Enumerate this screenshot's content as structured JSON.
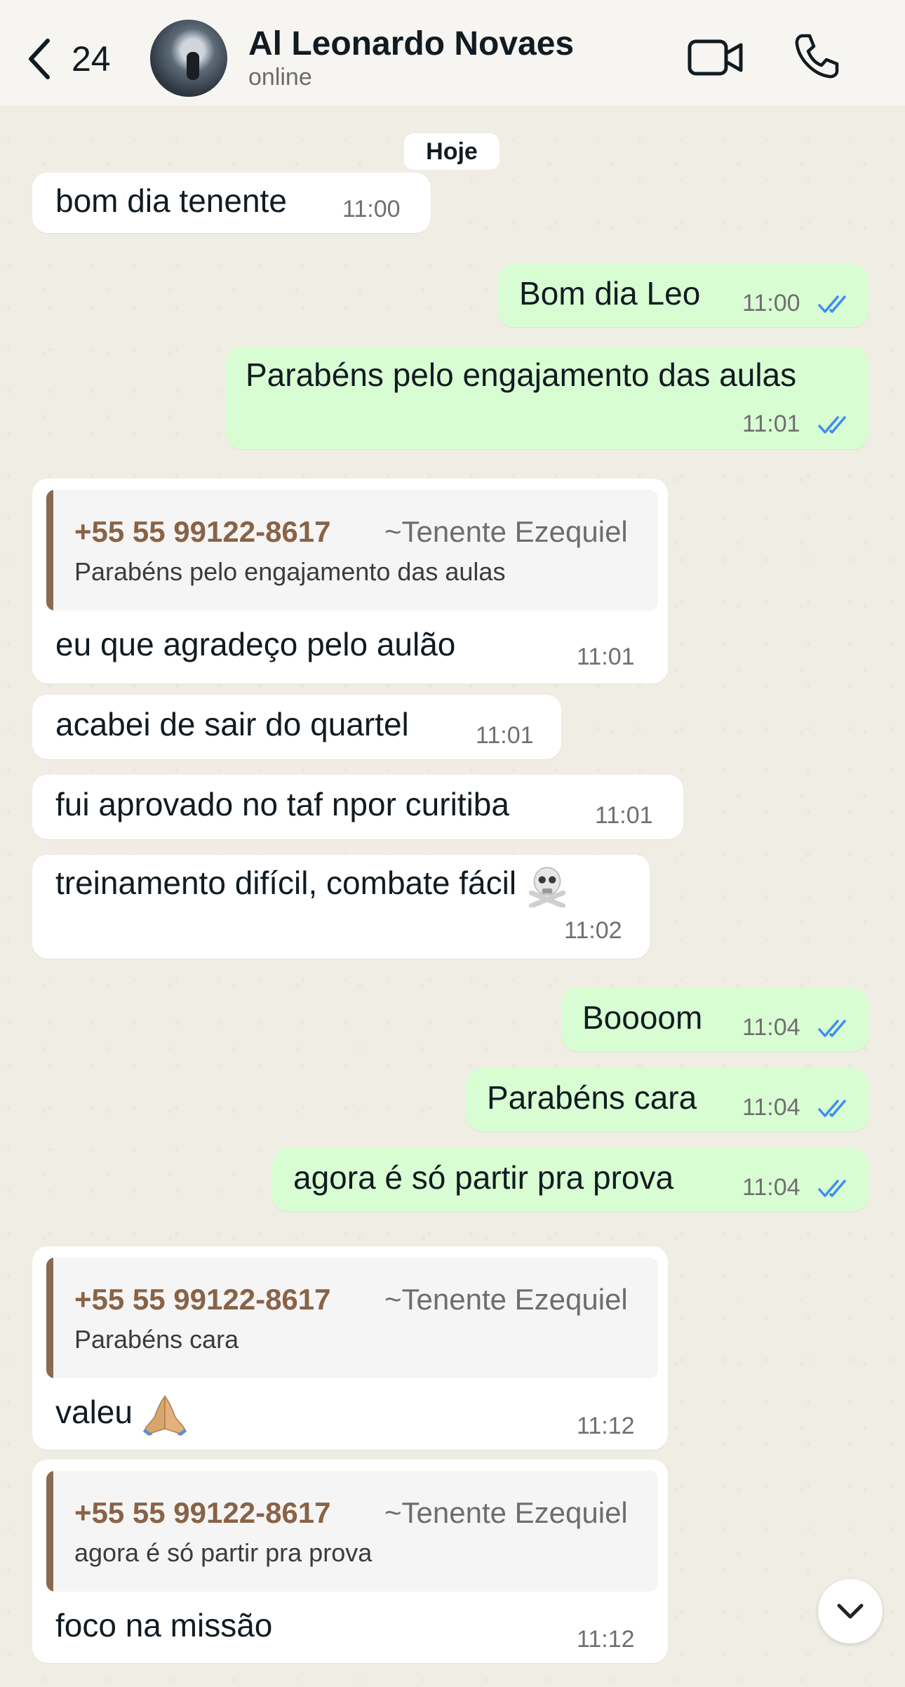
{
  "header": {
    "back_count": "24",
    "contact_name": "Al Leonardo Novaes",
    "status": "online"
  },
  "date_chip": "Hoje",
  "quote_phone": "+55 55 99122-8617",
  "quote_alias": "~Tenente Ezequiel",
  "messages": [
    {
      "dir": "in",
      "text": "bom dia tenente",
      "time": "11:00"
    },
    {
      "dir": "out",
      "text": "Bom dia Leo",
      "time": "11:00"
    },
    {
      "dir": "out",
      "text": "Parabéns pelo engajamento das aulas",
      "time": "11:01"
    },
    {
      "dir": "in",
      "quote": "Parabéns pelo engajamento das aulas",
      "text": "eu que agradeço pelo aulão",
      "time": "11:01"
    },
    {
      "dir": "in",
      "text": "acabei de sair do quartel",
      "time": "11:01"
    },
    {
      "dir": "in",
      "text": "fui aprovado no taf npor curitiba",
      "time": "11:01"
    },
    {
      "dir": "in",
      "text": "treinamento difícil, combate fácil",
      "emoji": "skull-crossbones",
      "time": "11:02"
    },
    {
      "dir": "out",
      "text": "Boooom",
      "time": "11:04"
    },
    {
      "dir": "out",
      "text": "Parabéns cara",
      "time": "11:04"
    },
    {
      "dir": "out",
      "text": "agora é só partir pra prova",
      "time": "11:04"
    },
    {
      "dir": "in",
      "quote": "Parabéns cara",
      "text": "valeu",
      "emoji": "folded-hands",
      "time": "11:12"
    },
    {
      "dir": "in",
      "quote": "agora é só partir pra prova",
      "text": "foco na missão",
      "time": "11:12"
    }
  ],
  "colors": {
    "incoming_bubble": "#ffffff",
    "outgoing_bubble": "#d9fdd3",
    "read_check": "#3b8ef0",
    "quote_phone": "#8a6246",
    "quote_bar": "#8b6a4f"
  }
}
